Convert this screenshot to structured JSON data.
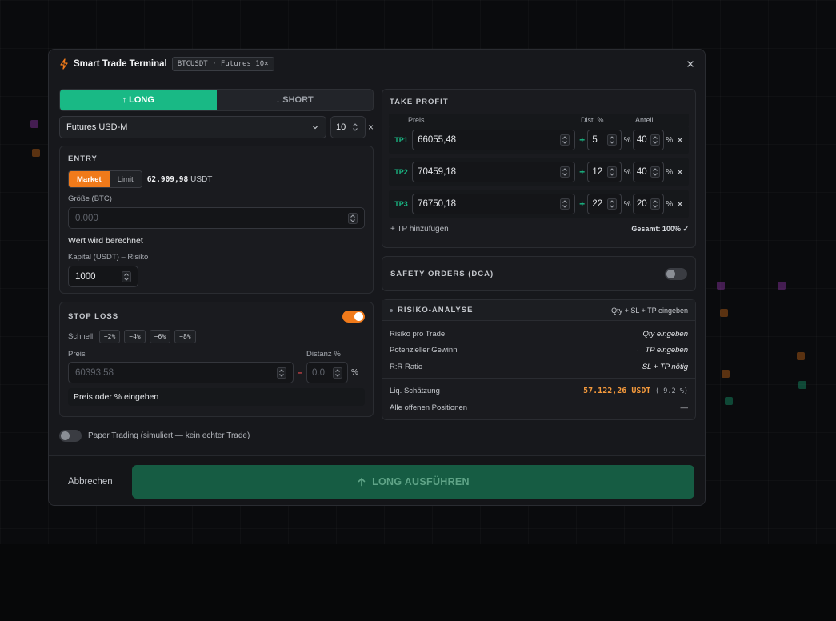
{
  "header": {
    "title": "Smart Trade Terminal",
    "badge": "BTCUSDT · Futures 10×"
  },
  "direction": {
    "long_label": "↑ LONG",
    "short_label": "↓ SHORT",
    "active": "long"
  },
  "market": {
    "selected": "Futures USD-M",
    "leverage": "10",
    "remove_glyph": "×"
  },
  "entry": {
    "title": "ENTRY",
    "mode_market": "Market",
    "mode_limit": "Limit",
    "price": "62.909,98",
    "price_unit": "USDT",
    "size_label": "Größe (BTC)",
    "size_placeholder": "0.000",
    "value_note": "Wert wird berechnet",
    "capital_label": "Kapital (USDT) – Risiko",
    "capital_value": "1000"
  },
  "stop_loss": {
    "title": "STOP LOSS",
    "enabled": true,
    "quick_label": "Schnell:",
    "quick_options": [
      "−2%",
      "−4%",
      "−6%",
      "−8%"
    ],
    "price_label": "Preis",
    "distance_label": "Distanz %",
    "price_placeholder": "60393.58",
    "minus_glyph": "–",
    "distance_placeholder": "0.0",
    "percent": "%",
    "hint": "Preis oder % eingeben"
  },
  "paper_trading": {
    "enabled": false,
    "label": "Paper Trading (simuliert — kein echter Trade)"
  },
  "take_profit": {
    "title": "TAKE PROFIT",
    "col_price": "Preis",
    "col_dist": "Dist. %",
    "col_share": "Anteil",
    "rows": [
      {
        "label": "TP1",
        "price": "66055,48",
        "dist": "5",
        "share": "40"
      },
      {
        "label": "TP2",
        "price": "70459,18",
        "dist": "12",
        "share": "40"
      },
      {
        "label": "TP3",
        "price": "76750,18",
        "dist": "22",
        "share": "20"
      }
    ],
    "add_label": "+  TP hinzufügen",
    "total_label": "Gesamt: 100% ✓",
    "plus": "+",
    "percent": "%"
  },
  "safety_orders": {
    "title": "SAFETY ORDERS (DCA)",
    "enabled": false
  },
  "risk": {
    "title": "RISIKO-ANALYSE",
    "hint": "Qty + SL + TP eingeben",
    "rows": [
      {
        "label": "Risiko pro Trade",
        "value": "Qty eingeben"
      },
      {
        "label": "Potenzieller Gewinn",
        "value": "← TP eingeben"
      },
      {
        "label": "R:R Ratio",
        "value": "SL + TP nötig"
      }
    ],
    "liq_label": "Liq. Schätzung",
    "liq_value": "57.122,26 USDT",
    "liq_pct": "(−9.2 %)",
    "open_label": "Alle offenen Positionen",
    "open_value": "—"
  },
  "footer": {
    "cancel_label": "Abbrechen",
    "execute_label": "LONG AUSFÜHREN"
  },
  "colors": {
    "long": "#19b985",
    "accent_orange": "#f07a1a",
    "liq": "#f59a3c",
    "short_minus": "#e5484d"
  }
}
